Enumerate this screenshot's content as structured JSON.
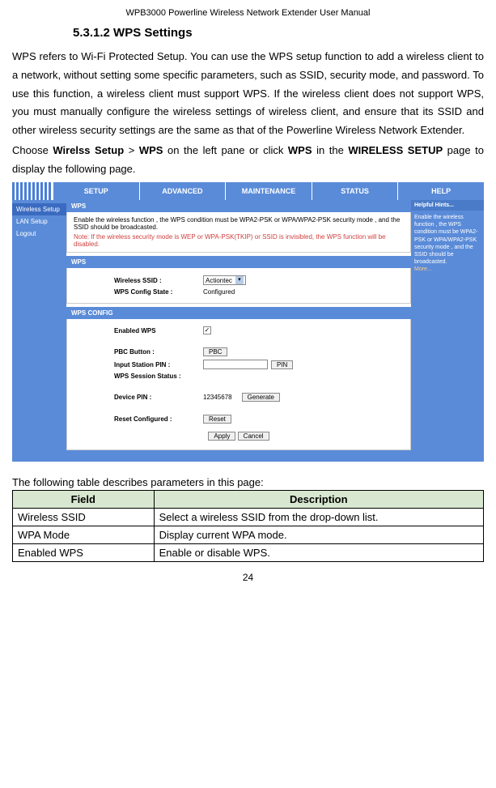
{
  "header": {
    "doc_title": "WPB3000 Powerline Wireless Network Extender User Manual"
  },
  "section": {
    "heading": "5.3.1.2 WPS Settings",
    "para1": "WPS refers to Wi-Fi Protected Setup. You can use the WPS setup function to add a wireless client to a network, without setting some specific parameters, such as SSID, security mode, and password. To use this function, a wireless client must support WPS. If the wireless client does not support WPS, you must manually configure the wireless settings of wireless client, and ensure that its SSID and other wireless security settings are the same as that of the Powerline Wireless Network Extender.",
    "para2_pre": "Choose ",
    "para2_b1": "Wirelss Setup",
    "para2_mid1": " > ",
    "para2_b2": "WPS",
    "para2_mid2": " on the left pane or click ",
    "para2_b3": "WPS",
    "para2_mid3": " in the ",
    "para2_b4": "WIRELESS SETUP",
    "para2_post": " page to display the following page."
  },
  "ui": {
    "topnav": {
      "setup": "SETUP",
      "advanced": "ADVANCED",
      "maintenance": "MAINTENANCE",
      "status": "STATUS",
      "help": "HELP"
    },
    "sidebar": {
      "items": [
        {
          "label": "Wireless Setup"
        },
        {
          "label": "LAN Setup"
        },
        {
          "label": "Logout"
        }
      ]
    },
    "wps_info": {
      "header": "WPS",
      "desc": "Enable the wireless function , the WPS condition must be WPA2-PSK or WPA/WPA2-PSK security mode , and the SSID should be broadcasted.",
      "note": "Note: If the wireless security mode is WEP or WPA-PSK(TKIP) or SSID is invisibled, the WPS function will be disabled."
    },
    "wps_panel": {
      "header": "WPS",
      "ssid_label": "Wireless SSID :",
      "ssid_value": "Actiontec",
      "config_state_label": "WPS Config State :",
      "config_state_value": "Configured"
    },
    "wps_config": {
      "header": "WPS CONFIG",
      "enabled_label": "Enabled WPS",
      "checkbox": "✓",
      "pbc_label": "PBC Button :",
      "pbc_btn": "PBC",
      "pin_label": "Input Station PIN :",
      "pin_btn": "PIN",
      "session_label": "WPS Session Status :",
      "device_pin_label": "Device PIN :",
      "device_pin_value": "12345678",
      "generate_btn": "Generate",
      "reset_label": "Reset Configured :",
      "reset_btn": "Reset",
      "apply_btn": "Apply",
      "cancel_btn": "Cancel"
    },
    "help": {
      "header": "Helpful Hints...",
      "body": "Enable the wireless function , the WPS condition must be WPA2-PSK or WPA/WPA2-PSK security mode , and the SSID should be broadcasted.",
      "more": "More..."
    }
  },
  "table": {
    "intro": "The following table describes parameters in this page:",
    "headers": {
      "field": "Field",
      "desc": "Description"
    },
    "rows": [
      {
        "field": "Wireless SSID",
        "desc": "Select a wireless SSID from the drop-down list."
      },
      {
        "field": "WPA Mode",
        "desc": "Display current WPA mode."
      },
      {
        "field": "Enabled WPS",
        "desc": "Enable or disable WPS."
      }
    ]
  },
  "page_number": "24"
}
